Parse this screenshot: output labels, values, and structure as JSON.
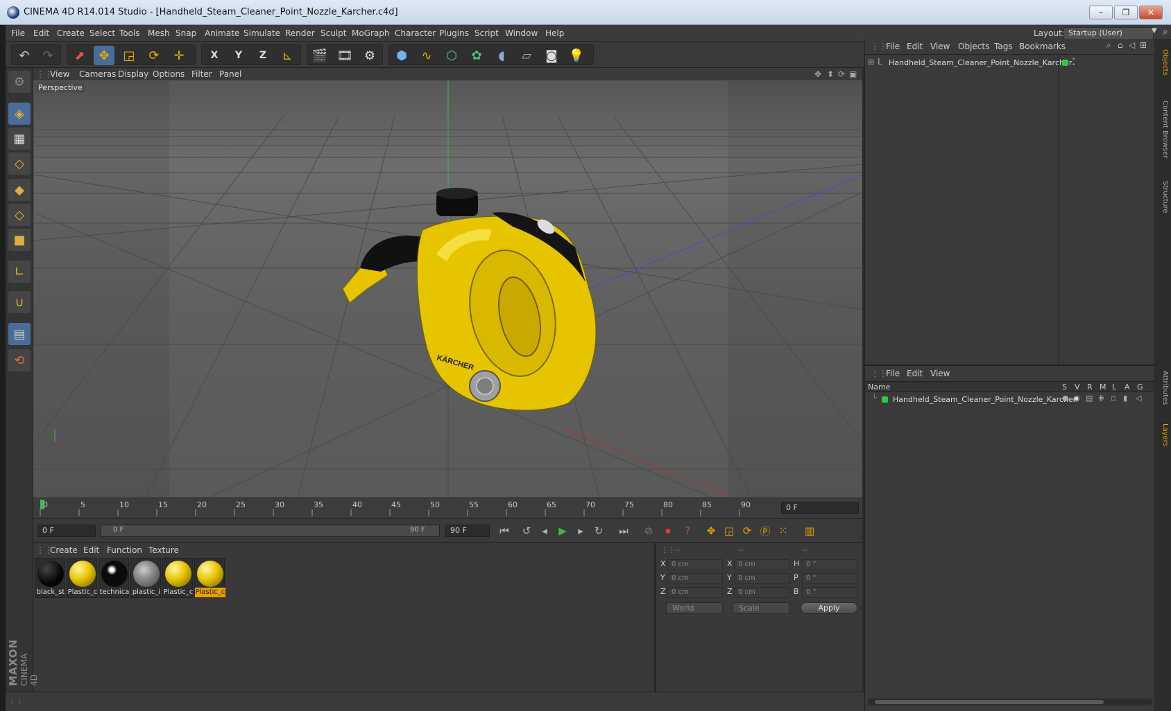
{
  "window": {
    "title": "CINEMA 4D R14.014 Studio - [Handheld_Steam_Cleaner_Point_Nozzle_Karcher.c4d]",
    "min": "–",
    "restore": "❐",
    "close": "✕"
  },
  "menubar": {
    "items": [
      "File",
      "Edit",
      "Create",
      "Select",
      "Tools",
      "Mesh",
      "Snap",
      "Animate",
      "Simulate",
      "Render",
      "Sculpt",
      "MoGraph",
      "Character",
      "Plugins",
      "Script",
      "Window",
      "Help"
    ],
    "layout_label": "Layout:",
    "layout_value": "Startup (User)"
  },
  "toolbar": {
    "icons": [
      "undo-icon",
      "redo-icon",
      "select-pointer-icon",
      "move-icon",
      "scale-icon",
      "rotate-icon",
      "add-object-icon",
      "x-axis-icon",
      "y-axis-icon",
      "z-axis-icon",
      "coordinate-system-icon",
      "render-view-icon",
      "render-picture-viewer-icon",
      "render-settings-icon",
      "cube-icon",
      "spline-icon",
      "nurbs-icon",
      "mograph-cloner-icon",
      "deformer-icon",
      "floor-icon",
      "camera-icon",
      "light-icon"
    ],
    "axis_x": "X",
    "axis_y": "Y",
    "axis_z": "Z"
  },
  "viewport": {
    "menu": [
      "View",
      "Cameras",
      "Display",
      "Options",
      "Filter",
      "Panel"
    ],
    "label": "Perspective",
    "logo_text": "KÄRCHER"
  },
  "timeline": {
    "ticks": [
      "0",
      "5",
      "10",
      "15",
      "20",
      "25",
      "30",
      "35",
      "40",
      "45",
      "50",
      "55",
      "60",
      "65",
      "70",
      "75",
      "80",
      "85",
      "90"
    ],
    "current_frame": "0 F",
    "start_field": "0 F",
    "range_start": "0 F",
    "range_end": "90 F",
    "end_field": "90 F"
  },
  "materials": {
    "menu": [
      "Create",
      "Edit",
      "Function",
      "Texture"
    ],
    "items": [
      {
        "name": "black_st",
        "color": "#050505"
      },
      {
        "name": "Plastic_c",
        "color": "#e6c400"
      },
      {
        "name": "technica",
        "color": "#0b0b0b"
      },
      {
        "name": "plastic_i",
        "color": "#8a8a8a"
      },
      {
        "name": "Plastic_c",
        "color": "#e6c400"
      },
      {
        "name": "Plastic_c",
        "color": "#e6c400"
      }
    ]
  },
  "coordinates": {
    "headers": [
      "--",
      "--",
      "--"
    ],
    "rows": [
      {
        "a": "X",
        "av": "0 cm",
        "b": "X",
        "bv": "0 cm",
        "c": "H",
        "cv": "0 °"
      },
      {
        "a": "Y",
        "av": "0 cm",
        "b": "Y",
        "bv": "0 cm",
        "c": "P",
        "cv": "0 °"
      },
      {
        "a": "Z",
        "av": "0 cm",
        "b": "Z",
        "bv": "0 cm",
        "c": "B",
        "cv": "0 °"
      }
    ],
    "world": "World",
    "scale": "Scale",
    "apply": "Apply"
  },
  "objects": {
    "menu": [
      "File",
      "Edit",
      "View",
      "Objects",
      "Tags",
      "Bookmarks"
    ],
    "item": "Handheld_Steam_Cleaner_Point_Nozzle_Karcher"
  },
  "layers": {
    "menu": [
      "File",
      "Edit",
      "View"
    ],
    "name_col": "Name",
    "flags": [
      "S",
      "V",
      "R",
      "M",
      "L",
      "A",
      "G"
    ],
    "item": "Handheld_Steam_Cleaner_Point_Nozzle_Karcher"
  },
  "sidetabs": [
    "Objects",
    "Content Browser",
    "Structure",
    "Attributes",
    "Layers"
  ],
  "branding": {
    "maxon": "MAXON",
    "cinema": "CINEMA 4D"
  },
  "colors": {
    "accent": "#e8a000",
    "selection": "#4a6c98",
    "green": "#2ecc40"
  }
}
